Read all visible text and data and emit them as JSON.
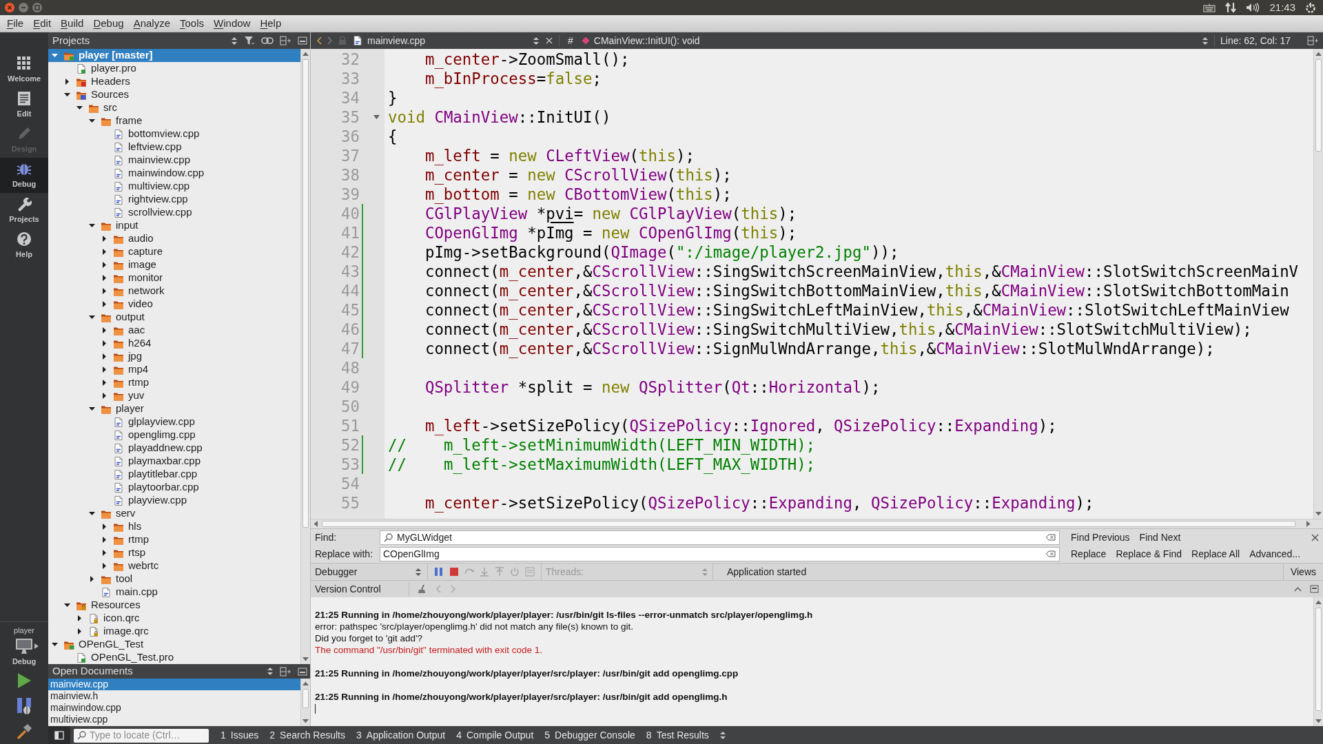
{
  "system_bar": {
    "clock": "21:43"
  },
  "menu_bar": [
    "File",
    "Edit",
    "Build",
    "Debug",
    "Analyze",
    "Tools",
    "Window",
    "Help"
  ],
  "mode_bar": {
    "modes": [
      {
        "label": "Welcome",
        "kind": "grid",
        "selected": false,
        "disabled": false
      },
      {
        "label": "Edit",
        "kind": "document",
        "selected": false,
        "disabled": false
      },
      {
        "label": "Design",
        "kind": "pencil",
        "selected": false,
        "disabled": true
      },
      {
        "label": "Debug",
        "kind": "bug",
        "selected": true,
        "disabled": false
      },
      {
        "label": "Projects",
        "kind": "wrench",
        "selected": false,
        "disabled": false
      },
      {
        "label": "Help",
        "kind": "help",
        "selected": false,
        "disabled": false
      }
    ],
    "target": {
      "project": "player",
      "build": "Debug"
    }
  },
  "projects_panel": {
    "title": "Projects",
    "tree": [
      {
        "label": "player [master]",
        "kind": "project",
        "startup": true,
        "expanded": true,
        "selected": true,
        "children": [
          {
            "label": "player.pro",
            "kind": "pro",
            "selected": false
          },
          {
            "label": "Headers",
            "kind": "headers",
            "expanded": false,
            "selected": false
          },
          {
            "label": "Sources",
            "kind": "sources",
            "expanded": true,
            "selected": false,
            "children": [
              {
                "label": "src",
                "kind": "folder",
                "expanded": true,
                "selected": false,
                "children": [
                  {
                    "label": "frame",
                    "kind": "folder",
                    "expanded": true,
                    "selected": false,
                    "children": [
                      {
                        "label": "bottomview.cpp",
                        "kind": "cpp",
                        "selected": false
                      },
                      {
                        "label": "leftview.cpp",
                        "kind": "cpp",
                        "selected": false
                      },
                      {
                        "label": "mainview.cpp",
                        "kind": "cpp",
                        "selected": false
                      },
                      {
                        "label": "mainwindow.cpp",
                        "kind": "cpp",
                        "selected": false
                      },
                      {
                        "label": "multiview.cpp",
                        "kind": "cpp",
                        "selected": false
                      },
                      {
                        "label": "rightview.cpp",
                        "kind": "cpp",
                        "selected": false
                      },
                      {
                        "label": "scrollview.cpp",
                        "kind": "cpp",
                        "selected": false
                      }
                    ]
                  },
                  {
                    "label": "input",
                    "kind": "folder",
                    "expanded": true,
                    "selected": false,
                    "children": [
                      {
                        "label": "audio",
                        "kind": "folder",
                        "expanded": false,
                        "selected": false
                      },
                      {
                        "label": "capture",
                        "kind": "folder",
                        "expanded": false,
                        "selected": false
                      },
                      {
                        "label": "image",
                        "kind": "folder",
                        "expanded": false,
                        "selected": false
                      },
                      {
                        "label": "monitor",
                        "kind": "folder",
                        "expanded": false,
                        "selected": false
                      },
                      {
                        "label": "network",
                        "kind": "folder",
                        "expanded": false,
                        "selected": false
                      },
                      {
                        "label": "video",
                        "kind": "folder",
                        "expanded": false,
                        "selected": false
                      }
                    ]
                  },
                  {
                    "label": "output",
                    "kind": "folder",
                    "expanded": true,
                    "selected": false,
                    "children": [
                      {
                        "label": "aac",
                        "kind": "folder",
                        "expanded": false,
                        "selected": false
                      },
                      {
                        "label": "h264",
                        "kind": "folder",
                        "expanded": false,
                        "selected": false
                      },
                      {
                        "label": "jpg",
                        "kind": "folder",
                        "expanded": false,
                        "selected": false
                      },
                      {
                        "label": "mp4",
                        "kind": "folder",
                        "expanded": false,
                        "selected": false
                      },
                      {
                        "label": "rtmp",
                        "kind": "folder",
                        "expanded": false,
                        "selected": false
                      },
                      {
                        "label": "yuv",
                        "kind": "folder",
                        "expanded": false,
                        "selected": false
                      }
                    ]
                  },
                  {
                    "label": "player",
                    "kind": "folder",
                    "expanded": true,
                    "selected": false,
                    "children": [
                      {
                        "label": "glplayview.cpp",
                        "kind": "cpp",
                        "selected": false
                      },
                      {
                        "label": "openglimg.cpp",
                        "kind": "cpp",
                        "selected": false
                      },
                      {
                        "label": "playaddnew.cpp",
                        "kind": "cpp",
                        "selected": false
                      },
                      {
                        "label": "playmaxbar.cpp",
                        "kind": "cpp",
                        "selected": false
                      },
                      {
                        "label": "playtitlebar.cpp",
                        "kind": "cpp",
                        "selected": false
                      },
                      {
                        "label": "playtoorbar.cpp",
                        "kind": "cpp",
                        "selected": false
                      },
                      {
                        "label": "playview.cpp",
                        "kind": "cpp",
                        "selected": false
                      }
                    ]
                  },
                  {
                    "label": "serv",
                    "kind": "folder",
                    "expanded": true,
                    "selected": false,
                    "children": [
                      {
                        "label": "hls",
                        "kind": "folder",
                        "expanded": false,
                        "selected": false
                      },
                      {
                        "label": "rtmp",
                        "kind": "folder",
                        "expanded": false,
                        "selected": false
                      },
                      {
                        "label": "rtsp",
                        "kind": "folder",
                        "expanded": false,
                        "selected": false
                      },
                      {
                        "label": "webrtc",
                        "kind": "folder",
                        "expanded": false,
                        "selected": false
                      }
                    ]
                  },
                  {
                    "label": "tool",
                    "kind": "folder",
                    "expanded": false,
                    "selected": false
                  },
                  {
                    "label": "main.cpp",
                    "kind": "cpp",
                    "selected": false
                  }
                ]
              }
            ]
          },
          {
            "label": "Resources",
            "kind": "resources",
            "expanded": true,
            "selected": false,
            "children": [
              {
                "label": "icon.qrc",
                "kind": "qrc",
                "expanded": false,
                "selected": false
              },
              {
                "label": "image.qrc",
                "kind": "qrc",
                "expanded": false,
                "selected": false
              }
            ]
          }
        ]
      },
      {
        "label": "OPenGL_Test",
        "kind": "project",
        "startup": false,
        "expanded": true,
        "selected": false,
        "children": [
          {
            "label": "OPenGL_Test.pro",
            "kind": "pro",
            "selected": false
          }
        ]
      }
    ]
  },
  "open_documents": {
    "title": "Open Documents",
    "items": [
      {
        "label": "mainview.cpp",
        "selected": true
      },
      {
        "label": "mainview.h",
        "selected": false
      },
      {
        "label": "mainwindow.cpp",
        "selected": false
      },
      {
        "label": "multiview.cpp",
        "selected": false
      }
    ]
  },
  "editor": {
    "toolbar": {
      "file": "mainview.cpp",
      "hash": "#",
      "symbol": "CMainView::InitUI(): void",
      "position": "Line: 62, Col: 17"
    },
    "lines": [
      {
        "number": "32",
        "changed": false,
        "fold": false,
        "indented": true,
        "tokens": [
          {
            "text": "m_center",
            "kind": "member"
          },
          {
            "text": "->ZoomSmall();",
            "kind": "plain"
          }
        ]
      },
      {
        "number": "33",
        "changed": false,
        "fold": false,
        "indented": true,
        "tokens": [
          {
            "text": "m_bInProcess",
            "kind": "member"
          },
          {
            "text": "=",
            "kind": "plain"
          },
          {
            "text": "false",
            "kind": "keyword"
          },
          {
            "text": ";",
            "kind": "plain"
          }
        ]
      },
      {
        "number": "34",
        "changed": false,
        "fold": false,
        "tokens": [
          {
            "text": "}",
            "kind": "plain"
          }
        ]
      },
      {
        "number": "35",
        "changed": false,
        "fold": true,
        "tokens": [
          {
            "text": "void ",
            "kind": "keyword"
          },
          {
            "text": "CMainView",
            "kind": "type"
          },
          {
            "text": "::InitUI()",
            "kind": "plain"
          }
        ]
      },
      {
        "number": "36",
        "changed": false,
        "fold": false,
        "tokens": [
          {
            "text": "{",
            "kind": "plain"
          }
        ]
      },
      {
        "number": "37",
        "changed": false,
        "fold": false,
        "indented": true,
        "tokens": [
          {
            "text": "m_left",
            "kind": "member"
          },
          {
            "text": " = ",
            "kind": "plain"
          },
          {
            "text": "new ",
            "kind": "keyword"
          },
          {
            "text": "CLeftView",
            "kind": "type"
          },
          {
            "text": "(",
            "kind": "plain"
          },
          {
            "text": "this",
            "kind": "keyword"
          },
          {
            "text": ");",
            "kind": "plain"
          }
        ]
      },
      {
        "number": "38",
        "changed": false,
        "fold": false,
        "indented": true,
        "tokens": [
          {
            "text": "m_center",
            "kind": "member"
          },
          {
            "text": " = ",
            "kind": "plain"
          },
          {
            "text": "new ",
            "kind": "keyword"
          },
          {
            "text": "CScrollView",
            "kind": "type"
          },
          {
            "text": "(",
            "kind": "plain"
          },
          {
            "text": "this",
            "kind": "keyword"
          },
          {
            "text": ");",
            "kind": "plain"
          }
        ]
      },
      {
        "number": "39",
        "changed": false,
        "fold": false,
        "indented": true,
        "tokens": [
          {
            "text": "m_bottom",
            "kind": "member"
          },
          {
            "text": " = ",
            "kind": "plain"
          },
          {
            "text": "new ",
            "kind": "keyword"
          },
          {
            "text": "CBottomView",
            "kind": "type"
          },
          {
            "text": "(",
            "kind": "plain"
          },
          {
            "text": "this",
            "kind": "keyword"
          },
          {
            "text": ");",
            "kind": "plain"
          }
        ]
      },
      {
        "number": "40",
        "changed": true,
        "fold": false,
        "indented": true,
        "tokens": [
          {
            "text": "CGlPlayView",
            "kind": "type"
          },
          {
            "text": " *",
            "kind": "plain"
          },
          {
            "text": "pvi",
            "kind": "local"
          },
          {
            "text": "= ",
            "kind": "plain"
          },
          {
            "text": "new ",
            "kind": "keyword"
          },
          {
            "text": "CGlPlayView",
            "kind": "type"
          },
          {
            "text": "(",
            "kind": "plain"
          },
          {
            "text": "this",
            "kind": "keyword"
          },
          {
            "text": ");",
            "kind": "plain"
          }
        ]
      },
      {
        "number": "41",
        "changed": true,
        "fold": false,
        "indented": true,
        "tokens": [
          {
            "text": "COpenGlImg",
            "kind": "type"
          },
          {
            "text": " *pImg = ",
            "kind": "plain"
          },
          {
            "text": "new ",
            "kind": "keyword"
          },
          {
            "text": "COpenGlImg",
            "kind": "type"
          },
          {
            "text": "(",
            "kind": "plain"
          },
          {
            "text": "this",
            "kind": "keyword"
          },
          {
            "text": ");",
            "kind": "plain"
          }
        ]
      },
      {
        "number": "42",
        "changed": true,
        "fold": false,
        "indented": true,
        "tokens": [
          {
            "text": "pImg->setBackground(",
            "kind": "plain"
          },
          {
            "text": "QImage",
            "kind": "type"
          },
          {
            "text": "(",
            "kind": "plain"
          },
          {
            "text": "\":/image/player2.jpg\"",
            "kind": "string"
          },
          {
            "text": "));",
            "kind": "plain"
          }
        ]
      },
      {
        "number": "43",
        "changed": true,
        "fold": false,
        "indented": true,
        "tokens": [
          {
            "text": "connect(",
            "kind": "plain"
          },
          {
            "text": "m_center",
            "kind": "member"
          },
          {
            "text": ",&",
            "kind": "plain"
          },
          {
            "text": "CScrollView",
            "kind": "type"
          },
          {
            "text": "::SingSwitchScreenMainView,",
            "kind": "plain"
          },
          {
            "text": "this",
            "kind": "keyword"
          },
          {
            "text": ",&",
            "kind": "plain"
          },
          {
            "text": "CMainView",
            "kind": "type"
          },
          {
            "text": "::SlotSwitchScreenMainV",
            "kind": "plain"
          }
        ]
      },
      {
        "number": "44",
        "changed": true,
        "fold": false,
        "indented": true,
        "tokens": [
          {
            "text": "connect(",
            "kind": "plain"
          },
          {
            "text": "m_center",
            "kind": "member"
          },
          {
            "text": ",&",
            "kind": "plain"
          },
          {
            "text": "CScrollView",
            "kind": "type"
          },
          {
            "text": "::SingSwitchBottomMainView,",
            "kind": "plain"
          },
          {
            "text": "this",
            "kind": "keyword"
          },
          {
            "text": ",&",
            "kind": "plain"
          },
          {
            "text": "CMainView",
            "kind": "type"
          },
          {
            "text": "::SlotSwitchBottomMain",
            "kind": "plain"
          }
        ]
      },
      {
        "number": "45",
        "changed": true,
        "fold": false,
        "indented": true,
        "tokens": [
          {
            "text": "connect(",
            "kind": "plain"
          },
          {
            "text": "m_center",
            "kind": "member"
          },
          {
            "text": ",&",
            "kind": "plain"
          },
          {
            "text": "CScrollView",
            "kind": "type"
          },
          {
            "text": "::SingSwitchLeftMainView,",
            "kind": "plain"
          },
          {
            "text": "this",
            "kind": "keyword"
          },
          {
            "text": ",&",
            "kind": "plain"
          },
          {
            "text": "CMainView",
            "kind": "type"
          },
          {
            "text": "::SlotSwitchLeftMainView",
            "kind": "plain"
          }
        ]
      },
      {
        "number": "46",
        "changed": true,
        "fold": false,
        "indented": true,
        "tokens": [
          {
            "text": "connect(",
            "kind": "plain"
          },
          {
            "text": "m_center",
            "kind": "member"
          },
          {
            "text": ",&",
            "kind": "plain"
          },
          {
            "text": "CScrollView",
            "kind": "type"
          },
          {
            "text": "::SingSwitchMultiView,",
            "kind": "plain"
          },
          {
            "text": "this",
            "kind": "keyword"
          },
          {
            "text": ",&",
            "kind": "plain"
          },
          {
            "text": "CMainView",
            "kind": "type"
          },
          {
            "text": "::SlotSwitchMultiView);",
            "kind": "plain"
          }
        ]
      },
      {
        "number": "47",
        "changed": true,
        "fold": false,
        "indented": true,
        "tokens": [
          {
            "text": "connect(",
            "kind": "plain"
          },
          {
            "text": "m_center",
            "kind": "member"
          },
          {
            "text": ",&",
            "kind": "plain"
          },
          {
            "text": "CScrollView",
            "kind": "type"
          },
          {
            "text": "::SignMulWndArrange,",
            "kind": "plain"
          },
          {
            "text": "this",
            "kind": "keyword"
          },
          {
            "text": ",&",
            "kind": "plain"
          },
          {
            "text": "CMainView",
            "kind": "type"
          },
          {
            "text": "::SlotMulWndArrange);",
            "kind": "plain"
          }
        ]
      },
      {
        "number": "48",
        "changed": false,
        "fold": false
      },
      {
        "number": "49",
        "changed": false,
        "fold": false,
        "indented": true,
        "tokens": [
          {
            "text": "QSplitter",
            "kind": "type"
          },
          {
            "text": " *split = ",
            "kind": "plain"
          },
          {
            "text": "new ",
            "kind": "keyword"
          },
          {
            "text": "QSplitter",
            "kind": "type"
          },
          {
            "text": "(",
            "kind": "plain"
          },
          {
            "text": "Qt",
            "kind": "type"
          },
          {
            "text": "::",
            "kind": "plain"
          },
          {
            "text": "Horizontal",
            "kind": "type"
          },
          {
            "text": ");",
            "kind": "plain"
          }
        ]
      },
      {
        "number": "50",
        "changed": false,
        "fold": false
      },
      {
        "number": "51",
        "changed": false,
        "fold": false,
        "indented": true,
        "tokens": [
          {
            "text": "m_left",
            "kind": "member"
          },
          {
            "text": "->setSizePolicy(",
            "kind": "plain"
          },
          {
            "text": "QSizePolicy",
            "kind": "type"
          },
          {
            "text": "::",
            "kind": "plain"
          },
          {
            "text": "Ignored",
            "kind": "type"
          },
          {
            "text": ", ",
            "kind": "plain"
          },
          {
            "text": "QSizePolicy",
            "kind": "type"
          },
          {
            "text": "::",
            "kind": "plain"
          },
          {
            "text": "Expanding",
            "kind": "type"
          },
          {
            "text": ");",
            "kind": "plain"
          }
        ]
      },
      {
        "number": "52",
        "changed": true,
        "fold": false,
        "tokens": [
          {
            "text": "//    m_left->setMinimumWidth(LEFT_MIN_WIDTH);",
            "kind": "comment"
          }
        ]
      },
      {
        "number": "53",
        "changed": true,
        "fold": false,
        "tokens": [
          {
            "text": "//    m_left->setMaximumWidth(LEFT_MAX_WIDTH);",
            "kind": "comment"
          }
        ]
      },
      {
        "number": "54",
        "changed": false,
        "fold": false
      },
      {
        "number": "55",
        "changed": false,
        "fold": false,
        "indented": true,
        "tokens": [
          {
            "text": "m_center",
            "kind": "member"
          },
          {
            "text": "->setSizePolicy(",
            "kind": "plain"
          },
          {
            "text": "QSizePolicy",
            "kind": "type"
          },
          {
            "text": "::",
            "kind": "plain"
          },
          {
            "text": "Expanding",
            "kind": "type"
          },
          {
            "text": ", ",
            "kind": "plain"
          },
          {
            "text": "QSizePolicy",
            "kind": "type"
          },
          {
            "text": "::",
            "kind": "plain"
          },
          {
            "text": "Expanding",
            "kind": "type"
          },
          {
            "text": ");",
            "kind": "plain"
          }
        ]
      }
    ]
  },
  "find_bar": {
    "find_label": "Find:",
    "find_value": "MyGLWidget",
    "replace_label": "Replace with:",
    "replace_value": "COpenGlImg",
    "find_buttons": [
      "Find Previous",
      "Find Next"
    ],
    "replace_buttons": [
      "Replace",
      "Replace & Find",
      "Replace All",
      "Advanced..."
    ]
  },
  "debugger_bar": {
    "perspective": "Debugger",
    "threads_label": "Threads:",
    "status": "Application started",
    "views": "Views"
  },
  "version_control": {
    "title": "Version Control",
    "output": [
      {
        "kind": "spacer"
      },
      {
        "kind": "command",
        "text": "21:25 Running in /home/zhouyong/work/player/player: /usr/bin/git ls-files --error-unmatch src/player/openglimg.h"
      },
      {
        "kind": "message",
        "text": "error: pathspec 'src/player/openglimg.h' did not match any file(s) known to git."
      },
      {
        "kind": "message",
        "text": "Did you forget to 'git add'?"
      },
      {
        "kind": "failure",
        "text": "The command \"/usr/bin/git\" terminated with exit code 1."
      },
      {
        "kind": "spacer"
      },
      {
        "kind": "command",
        "text": "21:25 Running in /home/zhouyong/work/player/player/src/player: /usr/bin/git add openglimg.cpp"
      },
      {
        "kind": "spacer"
      },
      {
        "kind": "command",
        "text": "21:25 Running in /home/zhouyong/work/player/player/src/player: /usr/bin/git add openglimg.h"
      },
      {
        "kind": "cursor"
      }
    ]
  },
  "status_bar": {
    "locate_placeholder": "Type to locate (Ctrl…",
    "tabs": [
      {
        "number": "1",
        "label": "Issues"
      },
      {
        "number": "2",
        "label": "Search Results"
      },
      {
        "number": "3",
        "label": "Application Output"
      },
      {
        "number": "4",
        "label": "Compile Output"
      },
      {
        "number": "5",
        "label": "Debugger Console"
      },
      {
        "number": "8",
        "label": "Test Results"
      }
    ]
  }
}
